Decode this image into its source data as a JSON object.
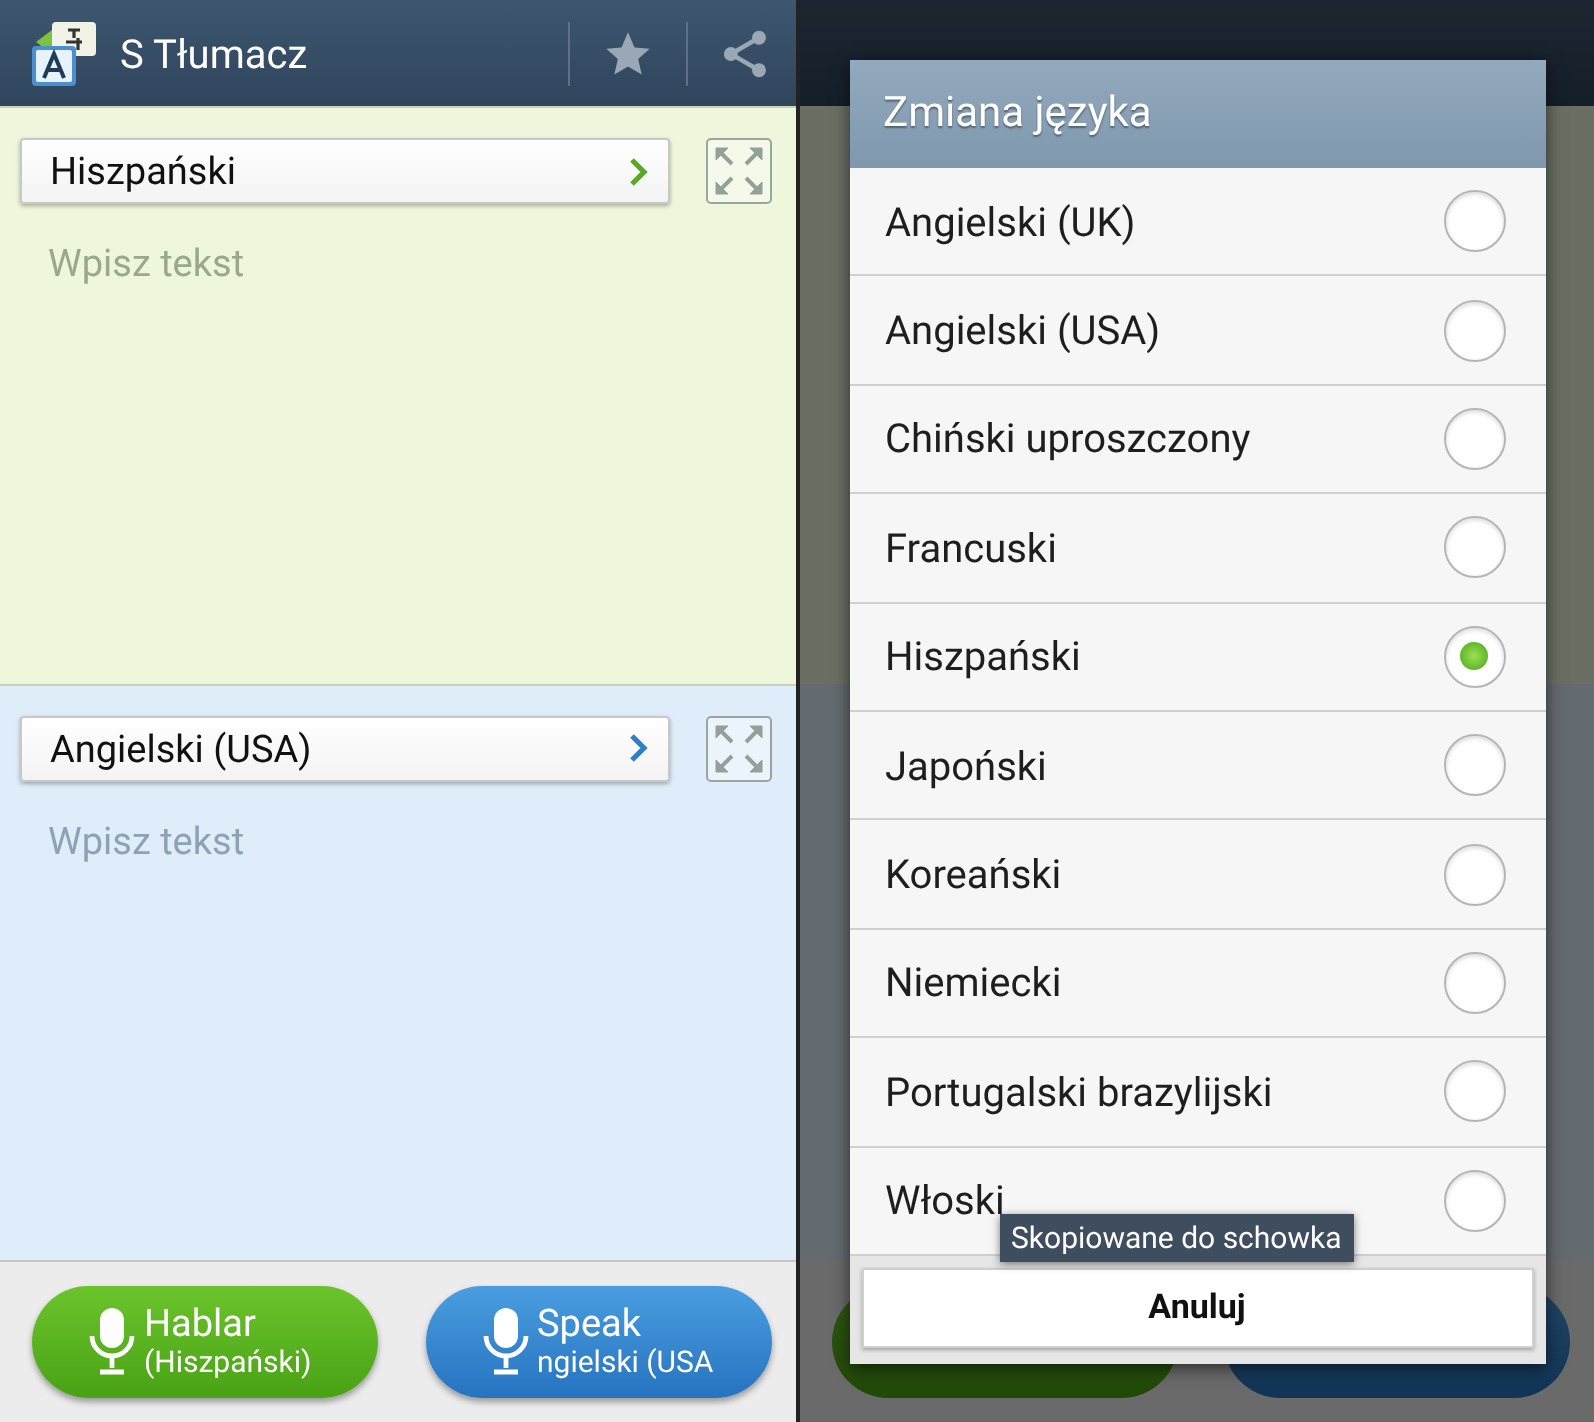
{
  "app_bar": {
    "title": "S Tłumacz"
  },
  "panels": [
    {
      "kind": "source",
      "language": "Hiszpański",
      "placeholder": "Wpisz tekst"
    },
    {
      "kind": "target",
      "language": "Angielski (USA)",
      "placeholder": "Wpisz tekst"
    }
  ],
  "voice_buttons": [
    {
      "kind": "source",
      "label": "Hablar",
      "language": "(Hiszpański)"
    },
    {
      "kind": "target",
      "label": "Speak",
      "language": "ngielski (USA"
    }
  ],
  "dialog": {
    "title": "Zmiana języka",
    "options": [
      {
        "label": "Angielski (UK)",
        "selected": false
      },
      {
        "label": "Angielski (USA)",
        "selected": false
      },
      {
        "label": "Chiński uproszczony",
        "selected": false
      },
      {
        "label": "Francuski",
        "selected": false
      },
      {
        "label": "Hiszpański",
        "selected": true
      },
      {
        "label": "Japoński",
        "selected": false
      },
      {
        "label": "Koreański",
        "selected": false
      },
      {
        "label": "Niemiecki",
        "selected": false
      },
      {
        "label": "Portugalski brazylijski",
        "selected": false
      },
      {
        "label": "Włoski",
        "selected": false
      }
    ],
    "cancel": "Anuluj"
  },
  "toast": "Skopiowane do schowka"
}
